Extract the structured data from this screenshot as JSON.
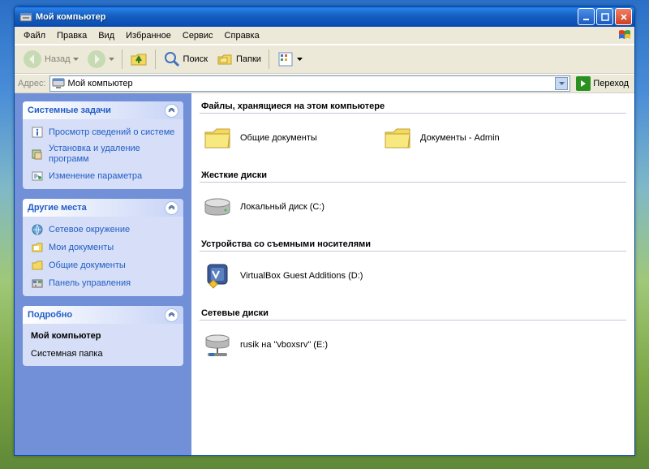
{
  "window": {
    "title": "Мой компьютер"
  },
  "menubar": {
    "items": [
      "Файл",
      "Правка",
      "Вид",
      "Избранное",
      "Сервис",
      "Справка"
    ]
  },
  "toolbar": {
    "back": "Назад",
    "search": "Поиск",
    "folders": "Папки"
  },
  "addressbar": {
    "label": "Адрес:",
    "value": "Мой компьютер",
    "go": "Переход"
  },
  "sidebar": {
    "panels": [
      {
        "title": "Системные задачи",
        "links": [
          {
            "icon": "info",
            "label": "Просмотр сведений о системе"
          },
          {
            "icon": "addrem",
            "label": "Установка и удаление программ"
          },
          {
            "icon": "config",
            "label": "Изменение параметра"
          }
        ]
      },
      {
        "title": "Другие места",
        "links": [
          {
            "icon": "network",
            "label": "Сетевое окружение"
          },
          {
            "icon": "mydocs",
            "label": "Мои документы"
          },
          {
            "icon": "shareddoc",
            "label": "Общие документы"
          },
          {
            "icon": "cpl",
            "label": "Панель управления"
          }
        ]
      },
      {
        "title": "Подробно",
        "info": {
          "name": "Мой компьютер",
          "type": "Системная папка"
        }
      }
    ]
  },
  "main": {
    "sections": [
      {
        "heading": "Файлы, хранящиеся на этом компьютере",
        "items": [
          {
            "icon": "folder",
            "label": "Общие документы"
          },
          {
            "icon": "folder",
            "label": "Документы - Admin"
          }
        ]
      },
      {
        "heading": "Жесткие диски",
        "items": [
          {
            "icon": "hdd",
            "label": "Локальный диск (C:)"
          }
        ]
      },
      {
        "heading": "Устройства со съемными носителями",
        "items": [
          {
            "icon": "vbox",
            "label": "VirtualBox Guest Additions (D:)"
          }
        ]
      },
      {
        "heading": "Сетевые диски",
        "items": [
          {
            "icon": "netdrive",
            "label": "rusik на \"vboxsrv\" (E:)"
          }
        ]
      }
    ]
  }
}
